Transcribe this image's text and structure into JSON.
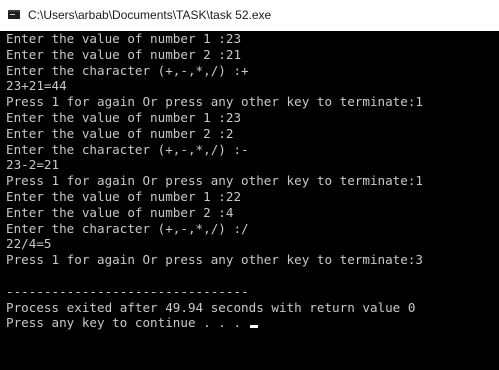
{
  "window": {
    "title": "C:\\Users\\arbab\\Documents\\TASK\\task 52.exe",
    "icon": "console-app-icon"
  },
  "console": {
    "lines": [
      "Enter the value of number 1 :23",
      "Enter the value of number 2 :21",
      "Enter the character (+,-,*,/) :+",
      "23+21=44",
      "Press 1 for again Or press any other key to terminate:1",
      "Enter the value of number 1 :23",
      "Enter the value of number 2 :2",
      "Enter the character (+,-,*,/) :-",
      "23-2=21",
      "Press 1 for again Or press any other key to terminate:1",
      "Enter the value of number 1 :22",
      "Enter the value of number 2 :4",
      "Enter the character (+,-,*,/) :/",
      "22/4=5",
      "Press 1 for again Or press any other key to terminate:3",
      "",
      "--------------------------------",
      "Process exited after 49.94 seconds with return value 0",
      "Press any key to continue . . . "
    ],
    "text_color": "#c8c8c8",
    "background_color": "#000000"
  }
}
